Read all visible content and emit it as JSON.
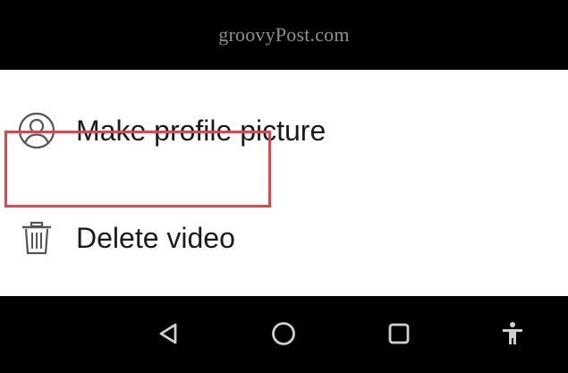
{
  "watermark": {
    "text": "groovyPost.com"
  },
  "menu": {
    "items": [
      {
        "label": "Make profile picture",
        "icon": "person-circle-icon"
      },
      {
        "label": "Delete video",
        "icon": "trash-icon",
        "highlighted": true
      }
    ]
  },
  "navbar": {
    "buttons": [
      {
        "icon": "back-triangle-icon"
      },
      {
        "icon": "home-circle-icon"
      },
      {
        "icon": "recents-square-icon"
      },
      {
        "icon": "accessibility-icon"
      }
    ]
  },
  "colors": {
    "highlight_border": "#e0474c",
    "icon_gray": "#555555",
    "nav_icon": "#cfcfcf",
    "text": "#1b1b1b"
  }
}
